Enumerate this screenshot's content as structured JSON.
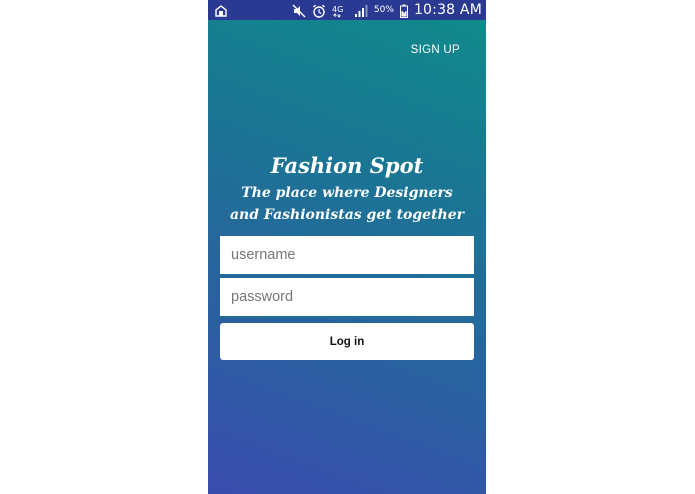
{
  "status_bar": {
    "network_type": "4G",
    "battery_percent": "50%",
    "time": "10:38 AM",
    "icons": [
      "notification-app-icon",
      "mute-icon",
      "alarm-icon",
      "4g-icon",
      "signal-icon",
      "battery-charging-icon"
    ]
  },
  "header": {
    "signup_label": "SIGN UP"
  },
  "brand": {
    "title": "Fashion Spot",
    "tagline": "The place where Designers and Fashionistas get together"
  },
  "form": {
    "username_placeholder": "username",
    "password_placeholder": "password",
    "login_label": "Log in"
  },
  "colors": {
    "gradient_top": "#0e8c8a",
    "gradient_mid": "#1f6f97",
    "gradient_bottom": "#3a4cae",
    "status_bar": "#2a3a92"
  }
}
